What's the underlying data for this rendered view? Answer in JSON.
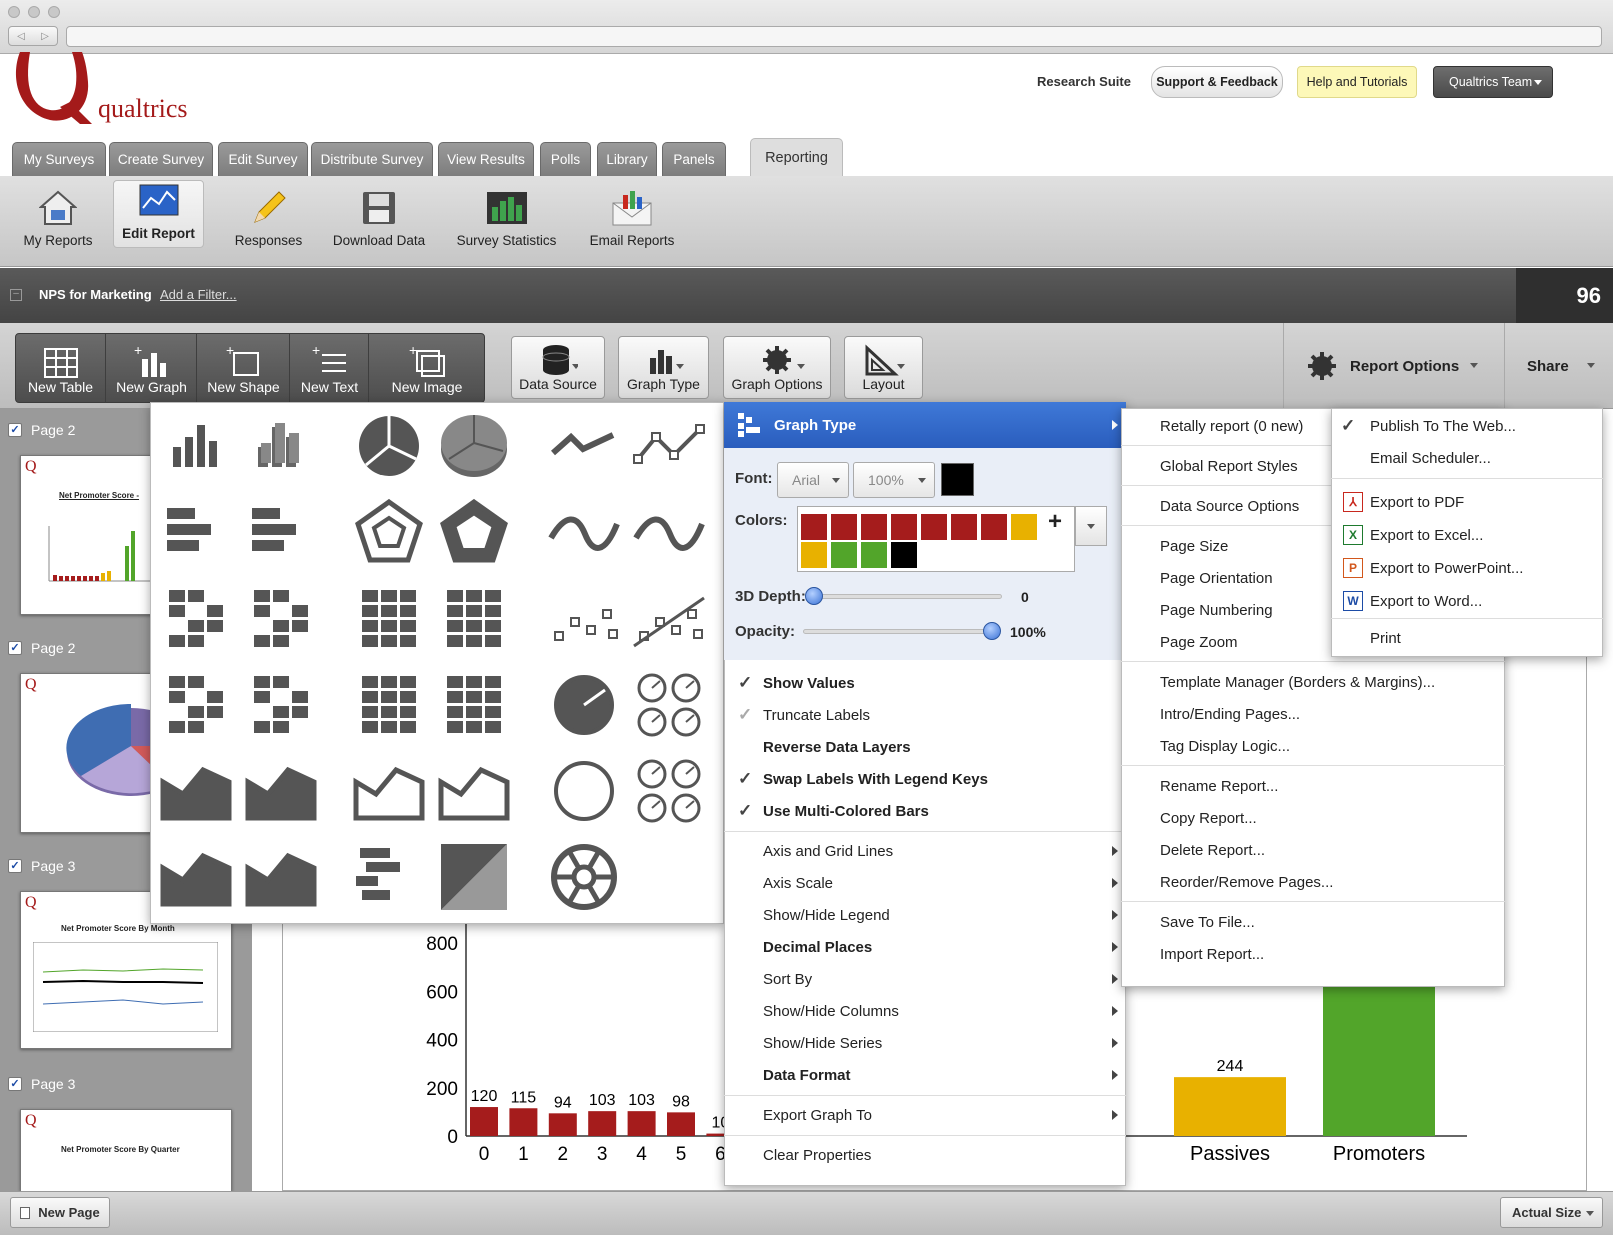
{
  "brand": {
    "logo_text": "qualtrics",
    "logo_letter": "Q"
  },
  "header": {
    "research_suite": "Research Suite",
    "support": "Support & Feedback",
    "help": "Help and Tutorials",
    "team": "Qualtrics Team"
  },
  "tabs": [
    "My Surveys",
    "Create Survey",
    "Edit Survey",
    "Distribute Survey",
    "View Results",
    "Polls",
    "Library",
    "Panels",
    "Reporting"
  ],
  "ribbon": [
    "My Reports",
    "Edit Report",
    "Responses",
    "Download Data",
    "Survey Statistics",
    "Email Reports"
  ],
  "filterbar": {
    "report_name": "NPS for Marketing",
    "add_filter": "Add a Filter...",
    "count": "96"
  },
  "toolbar": {
    "new_items": [
      "New Table",
      "New Graph",
      "New Shape",
      "New Text",
      "New Image"
    ],
    "tools": [
      "Data Source",
      "Graph Type",
      "Graph Options",
      "Layout"
    ],
    "report_options": "Report Options",
    "share": "Share"
  },
  "pages": [
    {
      "label": "Page 2",
      "thumb_title": "Net Promoter Score -"
    },
    {
      "label": "Page 2",
      "thumb_title": ""
    },
    {
      "label": "Page 3",
      "thumb_title": "Net Promoter Score By Month"
    },
    {
      "label": "Page 3",
      "thumb_title": "Net Promoter Score By Quarter"
    }
  ],
  "graph_options": {
    "header": "Graph Type",
    "font_label": "Font:",
    "font_value": "Arial",
    "size_value": "100%",
    "colors_label": "Colors:",
    "swatches_row1": [
      "#a51c1c",
      "#a51c1c",
      "#a51c1c",
      "#a51c1c",
      "#a51c1c",
      "#a51c1c",
      "#a51c1c",
      "#e8b100"
    ],
    "swatches_row2": [
      "#e8b100",
      "#52a52a",
      "#52a52a",
      "#000000"
    ],
    "depth_label": "3D Depth:",
    "depth_value": "0",
    "opacity_label": "Opacity:",
    "opacity_value": "100%",
    "toggles": [
      {
        "label": "Show Values",
        "checked": true,
        "bold": true
      },
      {
        "label": "Truncate Labels",
        "checked": true,
        "bold": false
      },
      {
        "label": "Reverse Data Layers",
        "checked": false,
        "bold": true
      },
      {
        "label": "Swap Labels With Legend Keys",
        "checked": true,
        "bold": true
      },
      {
        "label": "Use Multi-Colored Bars",
        "checked": true,
        "bold": true
      }
    ],
    "submenus": [
      "Axis and Grid Lines",
      "Axis Scale",
      "Show/Hide Legend",
      "Decimal Places",
      "Sort By",
      "Show/Hide Columns",
      "Show/Hide Series",
      "Data Format"
    ],
    "bold_submenus": [
      "Decimal Places",
      "Data Format"
    ],
    "export_graph": "Export Graph To",
    "clear": "Clear Properties"
  },
  "report_menu": {
    "groups": [
      [
        "Retally report (0 new)"
      ],
      [
        "Global Report Styles"
      ],
      [
        "Data Source Options"
      ],
      [
        "Page Size",
        "Page Orientation",
        "Page Numbering",
        "Page Zoom"
      ],
      [
        "Template Manager (Borders & Margins)...",
        "Intro/Ending Pages...",
        "Tag Display Logic..."
      ],
      [
        "Rename Report...",
        "Copy Report...",
        "Delete Report...",
        "Reorder/Remove Pages..."
      ],
      [
        "Save To File...",
        "Import Report..."
      ]
    ]
  },
  "share_menu": {
    "publish": "Publish To The Web...",
    "scheduler": "Email Scheduler...",
    "exports": [
      {
        "label": "Export to PDF",
        "icon": "pdf-icon",
        "color": "#c8281e"
      },
      {
        "label": "Export to Excel...",
        "icon": "excel-icon",
        "color": "#1e7a2e"
      },
      {
        "label": "Export to PowerPoint...",
        "icon": "powerpoint-icon",
        "color": "#d2571c"
      },
      {
        "label": "Export to Word...",
        "icon": "word-icon",
        "color": "#1d4ca6"
      }
    ],
    "print": "Print"
  },
  "chart_data": {
    "type": "bar",
    "ylim": [
      0,
      800
    ],
    "yticks": [
      0,
      200,
      400,
      600,
      800
    ],
    "left_bars": {
      "categories": [
        "0",
        "1",
        "2",
        "3",
        "4",
        "5",
        "6"
      ],
      "values": [
        120,
        115,
        94,
        103,
        103,
        98,
        10
      ],
      "color": "#a51c1c"
    },
    "right_bars": {
      "categories": [
        "Passives",
        "Promoters"
      ],
      "values": [
        244,
        null
      ],
      "colors": [
        "#e8b100",
        "#52a52a"
      ]
    }
  },
  "bottom": {
    "new_page": "New Page",
    "zoom": "Actual Size"
  }
}
